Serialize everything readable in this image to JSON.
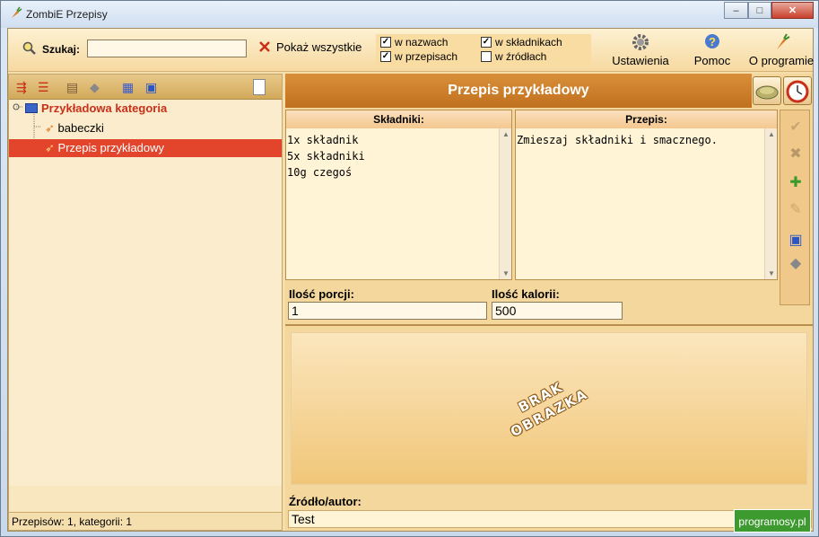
{
  "window": {
    "title": "ZombiE Przepisy",
    "min": "–",
    "max": "□",
    "close": "✕"
  },
  "toolbar": {
    "search_label": "Szukaj:",
    "search_value": "",
    "show_all": "Pokaż wszystkie",
    "checks": [
      {
        "label": "w nazwach",
        "checked": true
      },
      {
        "label": "w składnikach",
        "checked": true
      },
      {
        "label": "w przepisach",
        "checked": true
      },
      {
        "label": "w źródłach",
        "checked": false
      }
    ],
    "settings": "Ustawienia",
    "help": "Pomoc",
    "about": "O programie"
  },
  "tree": {
    "category": "Przykładowa kategoria",
    "items": [
      "babeczki",
      "Przepis przykładowy"
    ],
    "selected": "Przepis przykładowy"
  },
  "status": "Przepisów: 1, kategorii: 1",
  "recipe": {
    "title": "Przepis przykładowy",
    "ingredients_header": "Składniki:",
    "ingredients": "1x składnik\n5x składniki\n10g czegoś",
    "recipe_header": "Przepis:",
    "recipe_text": "Zmieszaj składniki i smacznego.",
    "portions_label": "Ilość porcji:",
    "portions_value": "1",
    "calories_label": "Ilość kalorii:",
    "calories_value": "500",
    "no_image_line1": "BRAK",
    "no_image_line2": "OBRAZKA",
    "source_label": "Źródło/autor:",
    "source_value": "Test"
  },
  "watermark": "programosy.pl",
  "colors": {
    "selected_row": "#e2452b",
    "header": "#c97a28",
    "category_text": "#c8301a"
  }
}
